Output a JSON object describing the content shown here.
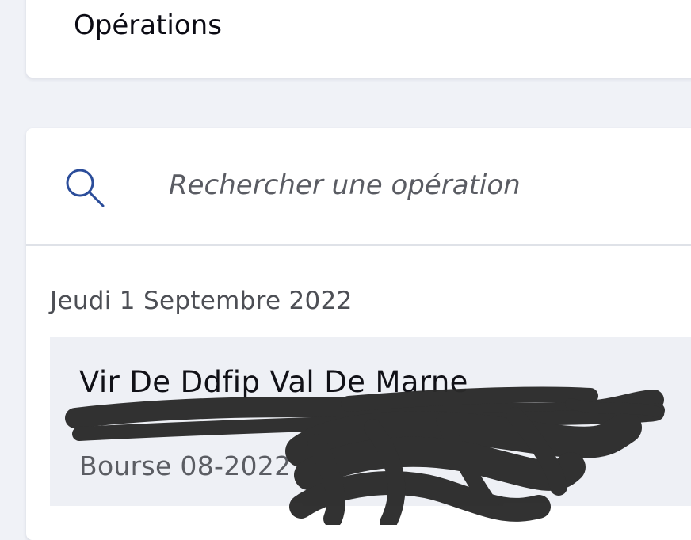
{
  "header": {
    "title": "Opérations"
  },
  "search": {
    "placeholder": "Rechercher une opération",
    "icon": "search-icon",
    "accent_color": "#2b4d9a"
  },
  "operations": {
    "groups": [
      {
        "date": "Jeudi 1 Septembre 2022",
        "items": [
          {
            "title": "Vir De Ddfip Val De Marne",
            "subtitle": "Bourse 08-2022"
          }
        ]
      }
    ]
  }
}
